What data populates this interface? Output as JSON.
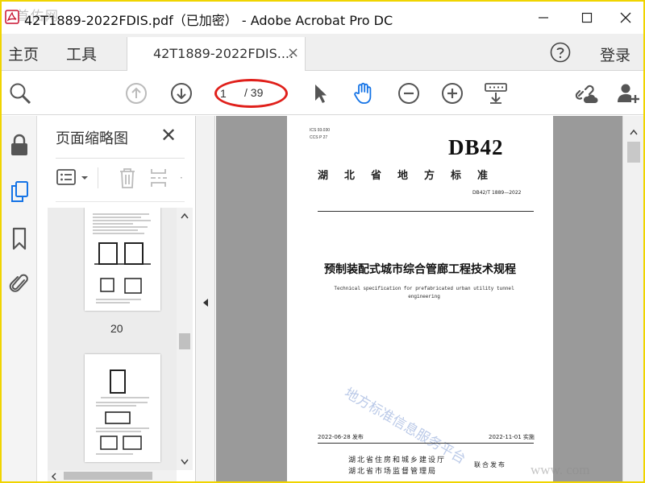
{
  "window": {
    "title": "42T1889-2022FDIS.pdf（已加密） - Adobe Acrobat Pro DC",
    "watermark": "首佑网"
  },
  "tabs": {
    "home": "主页",
    "tools": "工具",
    "document": "42T1889-2022FDIS....",
    "login": "登录"
  },
  "toolbar": {
    "current_page": "1",
    "total_pages": "/ 39"
  },
  "thumbnail_panel": {
    "title": "页面缩略图",
    "page_number_label": "20"
  },
  "document": {
    "ics": "ICS  93.030",
    "ccs": "CCS  P 27",
    "standard_prefix": "DB42",
    "level": "湖北省地方标准",
    "code": "DB42/T 1889—2022",
    "title_cn": "预制装配式城市综合管廊工程技术规程",
    "title_en": "Technical specification for prefabricated urban utility tunnel engineering",
    "issue_date": "2022-06-28 发布",
    "effective_date": "2022-11-01 实施",
    "issuer_1": "湖北省住房和城乡建设厅",
    "issuer_2": "湖北省市场监督管理局",
    "joint_issue": "联合发布",
    "watermark_text": "地方标准信息服务平台",
    "site_watermark": "www.        com"
  },
  "colors": {
    "accent_blue": "#1473e6",
    "annotation_red": "#e0201b",
    "border_yellow": "#f0d400"
  }
}
